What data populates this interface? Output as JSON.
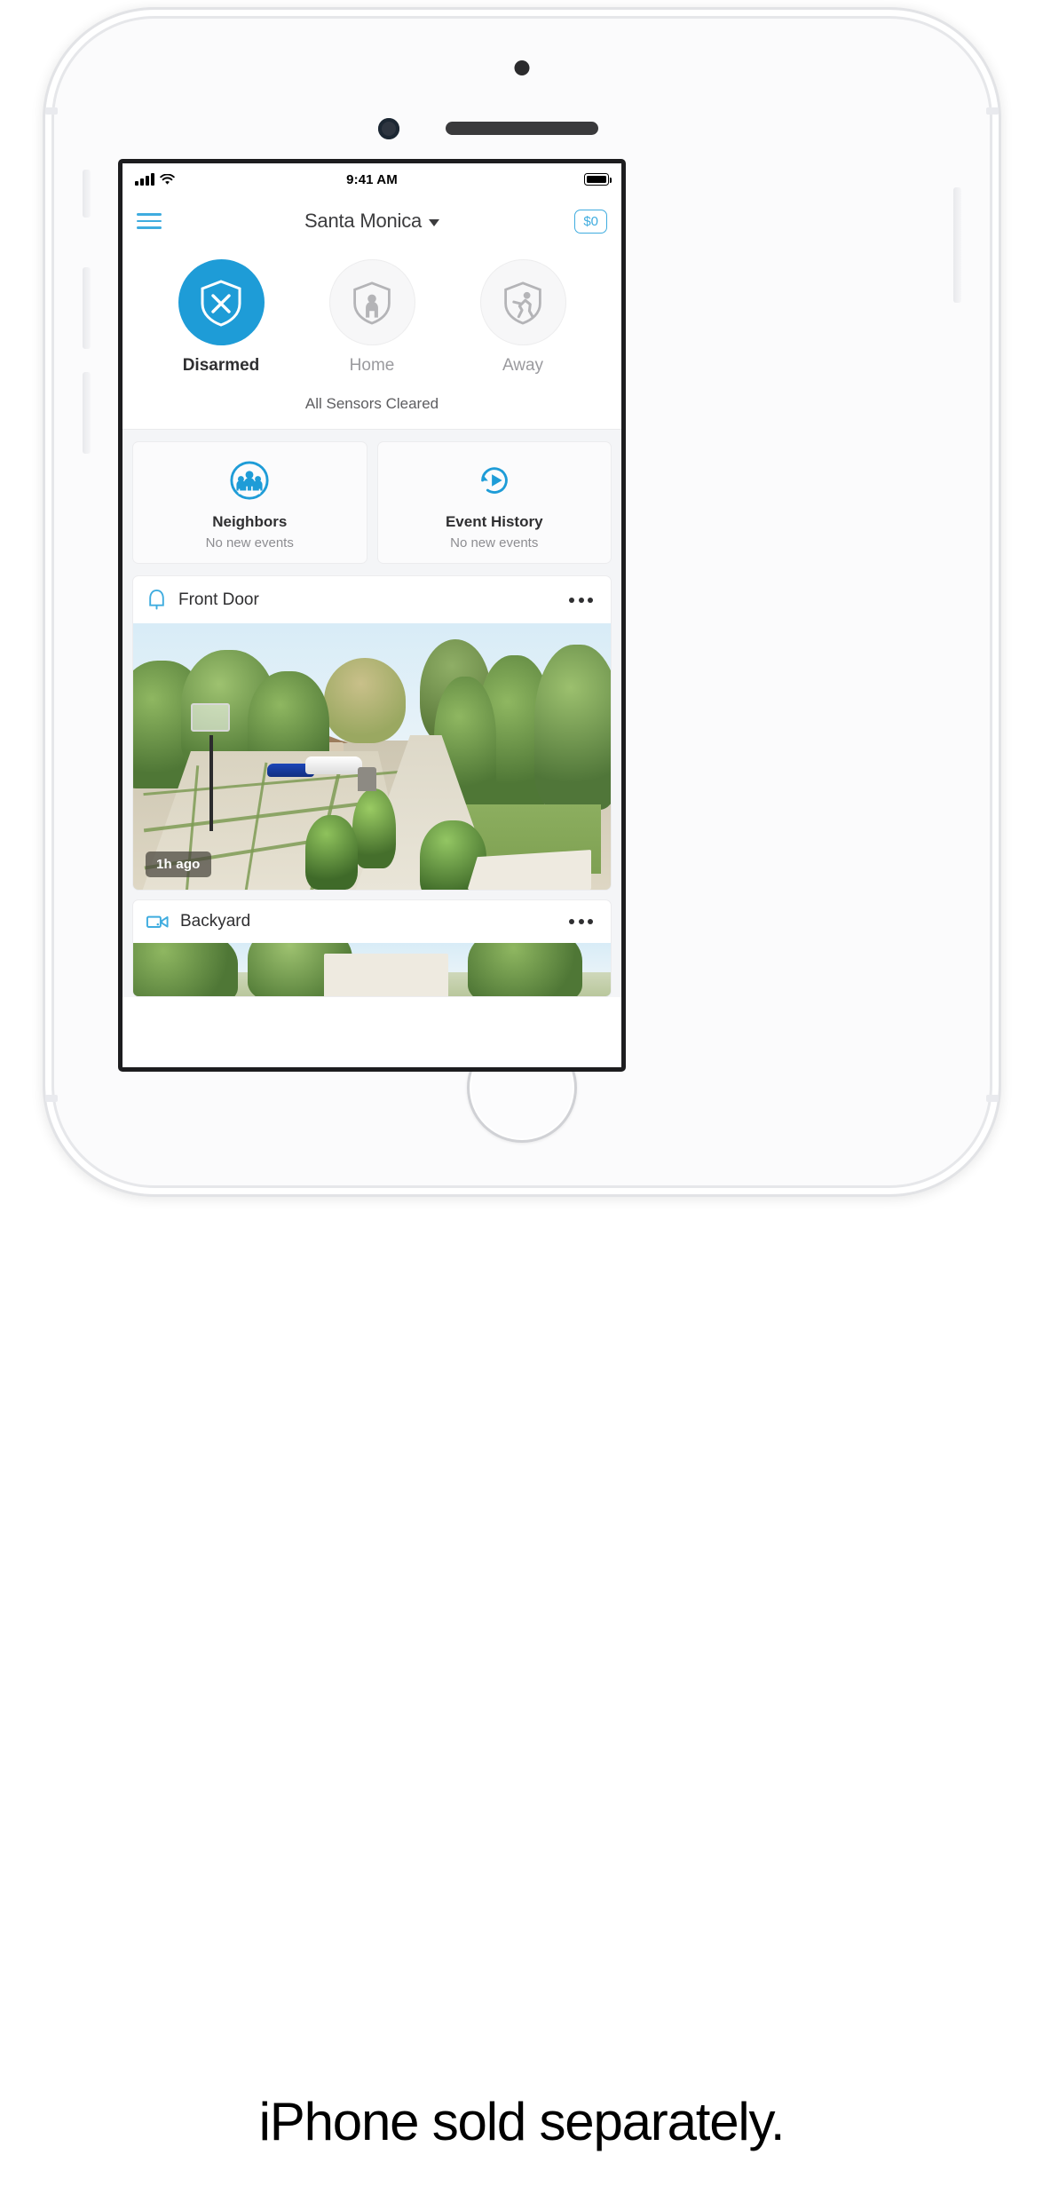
{
  "caption": "iPhone sold separately.",
  "status_bar": {
    "time": "9:41 AM",
    "signal_icon": "cellular-signal-icon",
    "wifi_icon": "wifi-icon",
    "battery_icon": "battery-full-icon"
  },
  "nav_bar": {
    "menu_icon": "hamburger-menu-icon",
    "location_title": "Santa Monica",
    "location_caret_icon": "caret-down-icon",
    "credit_badge": "$0"
  },
  "arm_panel": {
    "modes": [
      {
        "label": "Disarmed",
        "icon": "shield-x-icon",
        "active": true
      },
      {
        "label": "Home",
        "icon": "shield-person-icon",
        "active": false
      },
      {
        "label": "Away",
        "icon": "shield-running-person-icon",
        "active": false
      }
    ],
    "status_text": "All Sensors Cleared"
  },
  "quick_cards": [
    {
      "title": "Neighbors",
      "subtitle": "No new events",
      "icon": "neighbors-group-icon"
    },
    {
      "title": "Event History",
      "subtitle": "No new events",
      "icon": "history-replay-icon"
    }
  ],
  "devices": [
    {
      "name": "Front Door",
      "icon": "doorbell-bell-icon",
      "menu_icon": "more-options-icon",
      "timestamp": "1h ago",
      "has_preview": true
    },
    {
      "name": "Backyard",
      "icon": "video-camera-icon",
      "menu_icon": "more-options-icon",
      "timestamp": "",
      "has_preview": true
    }
  ],
  "colors": {
    "accent_blue": "#1e9cd7",
    "light_blue": "#3facdf",
    "text_dark": "#2f2f31",
    "text_muted": "#8d8d91",
    "panel_bg": "#f4f5f7"
  }
}
